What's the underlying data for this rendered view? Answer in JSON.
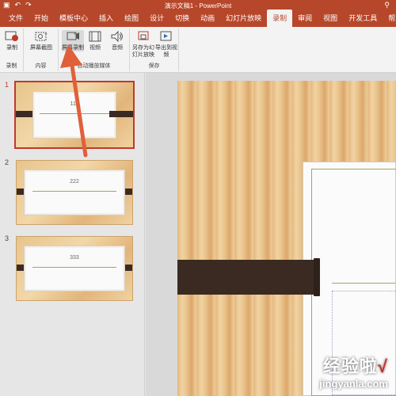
{
  "titlebar": {
    "title": "演示文稿1 - PowerPoint",
    "user_icon": "person-icon"
  },
  "tabs": [
    "文件",
    "开始",
    "模板中心",
    "插入",
    "绘图",
    "设计",
    "切换",
    "动画",
    "幻灯片放映",
    "录制",
    "审阅",
    "视图",
    "开发工具",
    "帮助"
  ],
  "active_tab": "录制",
  "ribbon": {
    "record": {
      "label": "录制",
      "group": "录制"
    },
    "screenshot": {
      "label": "屏幕截图",
      "group": "内容"
    },
    "screen_record": {
      "label": "屏幕录制"
    },
    "video": {
      "label": "视频"
    },
    "audio": {
      "label": "音频"
    },
    "automedia_group": "自动播放媒体",
    "save_as_show": {
      "label": "另存为幻灯片放映"
    },
    "export_video": {
      "label": "导出到视频"
    },
    "save_group": "保存"
  },
  "slides": [
    {
      "number": "1",
      "text": "111",
      "selected": true
    },
    {
      "number": "2",
      "text": "222",
      "selected": false
    },
    {
      "number": "3",
      "text": "333",
      "selected": false
    }
  ],
  "watermark": {
    "brand": "经验啦",
    "check": "√",
    "url": "jingyanla.com"
  },
  "colors": {
    "accent": "#b7472a",
    "selection": "#c0392b",
    "arrow": "#e0603a"
  }
}
